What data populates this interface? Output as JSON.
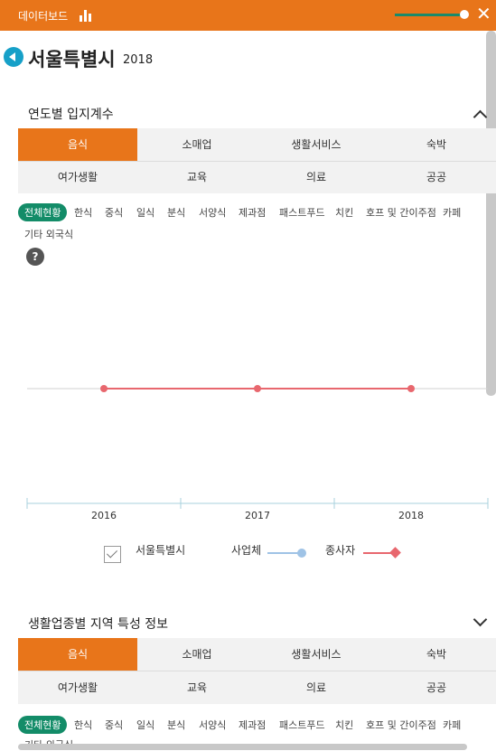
{
  "header": {
    "title": "데이터보드"
  },
  "page": {
    "region": "서울특별시",
    "year": "2018"
  },
  "section1": {
    "title": "연도별 입지계수",
    "tabs": [
      "음식",
      "소매업",
      "생활서비스",
      "숙박",
      "여가생활",
      "교육",
      "의료",
      "공공"
    ],
    "active_tab": "음식",
    "chips": [
      "전체현황",
      "한식",
      "중식",
      "일식",
      "분식",
      "서양식",
      "제과점",
      "패스트푸드",
      "치킨",
      "호프 및 간이주점",
      "카페",
      "기타 외국식"
    ],
    "help": "?"
  },
  "chart_data": {
    "type": "line",
    "x": [
      "2016",
      "2017",
      "2018"
    ],
    "series": [
      {
        "name": "사업체",
        "values": [
          null,
          null,
          null
        ],
        "color": "#9fc3e6"
      },
      {
        "name": "종사자",
        "values": [
          1,
          1,
          1
        ],
        "color": "#e8676e"
      }
    ],
    "ylim": [
      0,
      2
    ],
    "legend": {
      "checkbox_label": "서울특별시",
      "position": "bottom"
    }
  },
  "section2": {
    "title": "생활업종별 지역 특성 정보",
    "tabs": [
      "음식",
      "소매업",
      "생활서비스",
      "숙박",
      "여가생활",
      "교육",
      "의료",
      "공공"
    ],
    "active_tab": "음식",
    "chips": [
      "전체현황",
      "한식",
      "중식",
      "일식",
      "분식",
      "서양식",
      "제과점",
      "패스트푸드",
      "치킨",
      "호프 및 간이주점",
      "카페",
      "기타 외국식"
    ]
  }
}
